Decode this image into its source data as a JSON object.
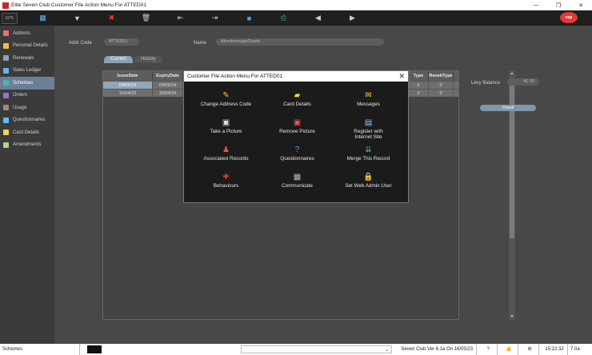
{
  "window": {
    "title": "Elite Seven Club Customer File Action Menu For ATTED01",
    "minimize": "—",
    "maximize": "❐",
    "close": "✕"
  },
  "toolbar": {
    "logo_text": "EPS",
    "brand": "esp",
    "buttons": [
      {
        "icon": "grid-icon",
        "glyph": "▦"
      },
      {
        "icon": "filter-icon",
        "glyph": "▼"
      },
      {
        "icon": "cancel-icon",
        "glyph": "✖"
      },
      {
        "icon": "delete-icon",
        "glyph": "🗑"
      },
      {
        "icon": "exit-icon",
        "glyph": "⇤"
      },
      {
        "icon": "enter-icon",
        "glyph": "⇥"
      },
      {
        "icon": "save-icon",
        "glyph": "■"
      },
      {
        "icon": "print-icon",
        "glyph": "⎙"
      },
      {
        "icon": "prev-icon",
        "glyph": "◀"
      },
      {
        "icon": "next-icon",
        "glyph": "▶"
      }
    ]
  },
  "sidebar": {
    "items": [
      {
        "label": "Address",
        "color": "#e57373"
      },
      {
        "label": "Personal Details",
        "color": "#ffb74d"
      },
      {
        "label": "Renewals",
        "color": "#90a4ae"
      },
      {
        "label": "Sales Ledger",
        "color": "#64b5f6"
      },
      {
        "label": "Schemes",
        "color": "#4db6ac",
        "active": true
      },
      {
        "label": "Orders",
        "color": "#9575cd"
      },
      {
        "label": "Usage",
        "color": "#a1887f"
      },
      {
        "label": "Questionnaires",
        "color": "#4fc3f7"
      },
      {
        "label": "Card Details",
        "color": "#ffd54f"
      },
      {
        "label": "Amendments",
        "color": "#aed581"
      }
    ]
  },
  "form": {
    "addr_code_label": "Addr Code",
    "addr_code_value": "ATTED01",
    "name_label": "Name",
    "name_value": "Attenborough/David",
    "levy_label": "Levy Balance",
    "levy_value": "41.00",
    "detail_button": "Detail"
  },
  "tabs": [
    {
      "label": "Current",
      "active": true
    },
    {
      "label": "History",
      "active": false
    }
  ],
  "grid": {
    "headers": [
      "IssueDate",
      "ExpiryDate",
      "Type",
      "RenebType"
    ],
    "rows": [
      {
        "issue": "09/05/24",
        "expiry": "09/05/24",
        "type": "5",
        "reneb": "0"
      },
      {
        "issue": "16/04/23",
        "expiry": "16/04/24",
        "type": "2",
        "reneb": "0"
      }
    ]
  },
  "modal": {
    "title": "Customer File Action Menu For ATTED01",
    "close": "✕",
    "actions": [
      {
        "label": "Change Address Code",
        "icon": "change-address-icon",
        "glyph": "✎",
        "color": "#ffca28"
      },
      {
        "label": "Card Details",
        "icon": "card-icon",
        "glyph": "▰",
        "color": "#fdd835"
      },
      {
        "label": "Messages",
        "icon": "message-icon",
        "glyph": "✉",
        "color": "#fdd835"
      },
      {
        "label": "Take a Picture",
        "icon": "camera-icon",
        "glyph": "▣",
        "color": "#e0e0e0"
      },
      {
        "label": "Remove Picture",
        "icon": "remove-picture-icon",
        "glyph": "▣",
        "color": "#ef5350"
      },
      {
        "label": "Register with Internet Site",
        "icon": "register-icon",
        "glyph": "▤",
        "color": "#90caf9"
      },
      {
        "label": "Associated Records",
        "icon": "people-icon",
        "glyph": "♟",
        "color": "#ef5350"
      },
      {
        "label": "Questionnaires",
        "icon": "question-icon",
        "glyph": "?",
        "color": "#42a5f5"
      },
      {
        "label": "Merge This Record",
        "icon": "merge-icon",
        "glyph": "⇊",
        "color": "#66bb6a"
      },
      {
        "label": "Behaviours",
        "icon": "behaviour-icon",
        "glyph": "✚",
        "color": "#e53935"
      },
      {
        "label": "Communicate",
        "icon": "communicate-icon",
        "glyph": "▦",
        "color": "#b0bec5"
      },
      {
        "label": "Set Web Admin User",
        "icon": "lock-icon",
        "glyph": "🔒",
        "color": "#ffca28"
      }
    ]
  },
  "status": {
    "section": "Schemes",
    "dropdown_value": "",
    "version": "Seven Club Ver 6.1a On 16/05/23",
    "time": "15:22:32",
    "ver_short": "7.0a"
  }
}
